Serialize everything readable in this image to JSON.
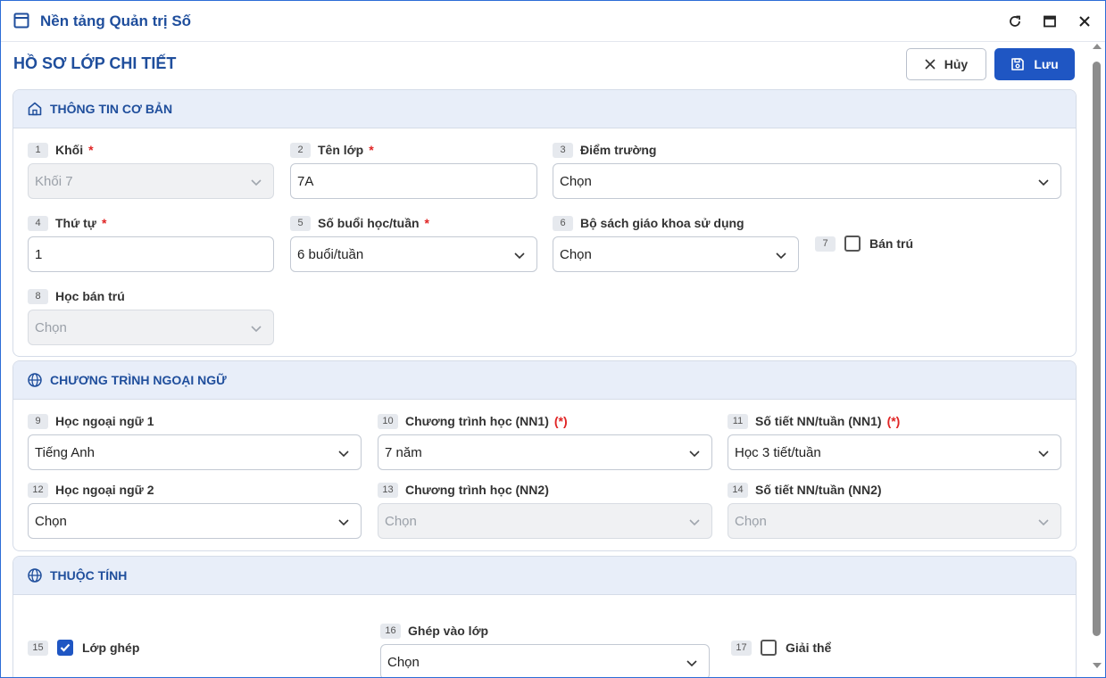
{
  "window": {
    "title": "Nền tảng Quản trị Số"
  },
  "page": {
    "title": "HỒ SƠ LỚP CHI TIẾT",
    "cancel_label": "Hủy",
    "save_label": "Lưu"
  },
  "colors": {
    "primary": "#1f56c3",
    "title_blue": "#1f4e9c",
    "section_bg": "#e8eef9",
    "required": "#e02424"
  },
  "sections": {
    "basic": {
      "title": "THÔNG TIN CƠ BẢN",
      "icon": "home-icon",
      "fields": {
        "grade": {
          "num": "1",
          "label": "Khối",
          "required": "*",
          "value": "Khối 7",
          "disabled": true
        },
        "class_name": {
          "num": "2",
          "label": "Tên lớp",
          "required": "*",
          "value": "7A"
        },
        "campus": {
          "num": "3",
          "label": "Điểm trường",
          "value": "Chọn"
        },
        "order": {
          "num": "4",
          "label": "Thứ tự",
          "required": "*",
          "value": "1"
        },
        "sessions": {
          "num": "5",
          "label": "Số buổi học/tuần",
          "required": "*",
          "value": "6 buổi/tuần"
        },
        "textbook": {
          "num": "6",
          "label": "Bộ sách giáo khoa sử dụng",
          "value": "Chọn"
        },
        "boarding": {
          "num": "7",
          "label": "Bán trú",
          "checked": false
        },
        "boarding_study": {
          "num": "8",
          "label": "Học bán trú",
          "value": "Chọn",
          "disabled": true
        }
      }
    },
    "foreign": {
      "title": "CHƯƠNG TRÌNH NGOẠI NGỮ",
      "icon": "globe-icon",
      "fields": {
        "lang1": {
          "num": "9",
          "label": "Học ngoại ngữ 1",
          "value": "Tiếng Anh"
        },
        "program1": {
          "num": "10",
          "label": "Chương trình học (NN1)",
          "required": "(*)",
          "value": "7 năm"
        },
        "periods1": {
          "num": "11",
          "label": "Số tiết NN/tuần (NN1)",
          "required": "(*)",
          "value": "Học 3 tiết/tuần"
        },
        "lang2": {
          "num": "12",
          "label": "Học ngoại ngữ 2",
          "value": "Chọn"
        },
        "program2": {
          "num": "13",
          "label": "Chương trình học (NN2)",
          "value": "Chọn",
          "disabled": true
        },
        "periods2": {
          "num": "14",
          "label": "Số tiết NN/tuần (NN2)",
          "value": "Chọn",
          "disabled": true
        }
      }
    },
    "attributes": {
      "title": "THUỘC TÍNH",
      "icon": "globe-icon",
      "fields": {
        "merged": {
          "num": "15",
          "label": "Lớp ghép",
          "checked": true
        },
        "merge_into": {
          "num": "16",
          "label": "Ghép vào lớp",
          "value": "Chọn"
        },
        "dissolved": {
          "num": "17",
          "label": "Giải thể",
          "checked": false
        }
      }
    }
  }
}
